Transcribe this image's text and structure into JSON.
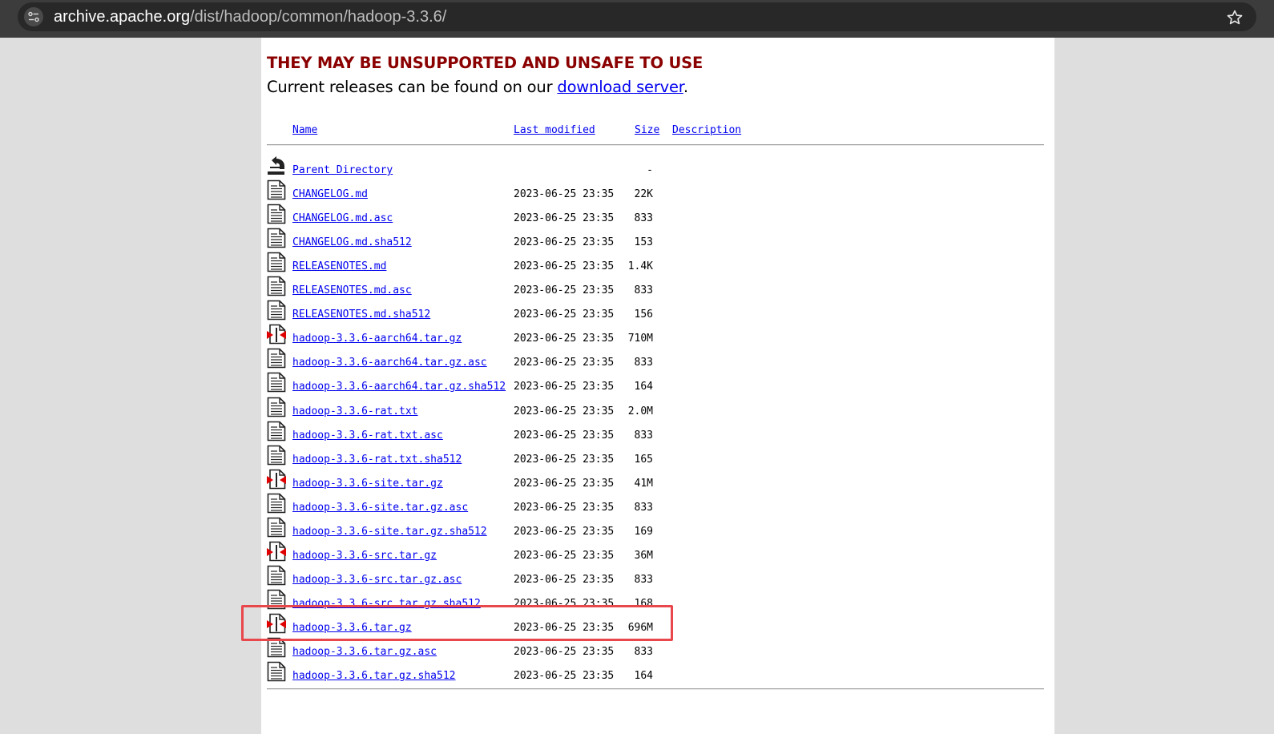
{
  "browser": {
    "url_host": "archive.apache.org",
    "url_path": "/dist/hadoop/common/hadoop-3.3.6/"
  },
  "page": {
    "warning": "THEY MAY BE UNSUPPORTED AND UNSAFE TO USE",
    "current_prefix": "Current releases can be found on our ",
    "current_link": "download server",
    "current_suffix": "."
  },
  "table": {
    "headers": {
      "name": "Name",
      "last_modified": "Last modified",
      "size": "Size",
      "description": "Description"
    },
    "rows": [
      {
        "icon": "back-arrow-icon",
        "name": "Parent Directory",
        "date": "",
        "size": "-"
      },
      {
        "icon": "text-file-icon",
        "name": "CHANGELOG.md",
        "date": "2023-06-25 23:35",
        "size": "22K"
      },
      {
        "icon": "text-file-icon",
        "name": "CHANGELOG.md.asc",
        "date": "2023-06-25 23:35",
        "size": "833"
      },
      {
        "icon": "text-file-icon",
        "name": "CHANGELOG.md.sha512",
        "date": "2023-06-25 23:35",
        "size": "153"
      },
      {
        "icon": "text-file-icon",
        "name": "RELEASENOTES.md",
        "date": "2023-06-25 23:35",
        "size": "1.4K"
      },
      {
        "icon": "text-file-icon",
        "name": "RELEASENOTES.md.asc",
        "date": "2023-06-25 23:35",
        "size": "833"
      },
      {
        "icon": "text-file-icon",
        "name": "RELEASENOTES.md.sha512",
        "date": "2023-06-25 23:35",
        "size": "156"
      },
      {
        "icon": "compressed-file-icon",
        "name": "hadoop-3.3.6-aarch64.tar.gz",
        "date": "2023-06-25 23:35",
        "size": "710M"
      },
      {
        "icon": "text-file-icon",
        "name": "hadoop-3.3.6-aarch64.tar.gz.asc",
        "date": "2023-06-25 23:35",
        "size": "833"
      },
      {
        "icon": "text-file-icon",
        "name": "hadoop-3.3.6-aarch64.tar.gz.sha512",
        "date": "2023-06-25 23:35",
        "size": "164"
      },
      {
        "icon": "text-file-icon",
        "name": "hadoop-3.3.6-rat.txt",
        "date": "2023-06-25 23:35",
        "size": "2.0M"
      },
      {
        "icon": "text-file-icon",
        "name": "hadoop-3.3.6-rat.txt.asc",
        "date": "2023-06-25 23:35",
        "size": "833"
      },
      {
        "icon": "text-file-icon",
        "name": "hadoop-3.3.6-rat.txt.sha512",
        "date": "2023-06-25 23:35",
        "size": "165"
      },
      {
        "icon": "compressed-file-icon",
        "name": "hadoop-3.3.6-site.tar.gz",
        "date": "2023-06-25 23:35",
        "size": "41M"
      },
      {
        "icon": "text-file-icon",
        "name": "hadoop-3.3.6-site.tar.gz.asc",
        "date": "2023-06-25 23:35",
        "size": "833"
      },
      {
        "icon": "text-file-icon",
        "name": "hadoop-3.3.6-site.tar.gz.sha512",
        "date": "2023-06-25 23:35",
        "size": "169"
      },
      {
        "icon": "compressed-file-icon",
        "name": "hadoop-3.3.6-src.tar.gz",
        "date": "2023-06-25 23:35",
        "size": "36M"
      },
      {
        "icon": "text-file-icon",
        "name": "hadoop-3.3.6-src.tar.gz.asc",
        "date": "2023-06-25 23:35",
        "size": "833"
      },
      {
        "icon": "text-file-icon",
        "name": "hadoop-3.3.6-src.tar.gz.sha512",
        "date": "2023-06-25 23:35",
        "size": "168"
      },
      {
        "icon": "compressed-file-icon",
        "name": "hadoop-3.3.6.tar.gz",
        "date": "2023-06-25 23:35",
        "size": "696M"
      },
      {
        "icon": "text-file-icon",
        "name": "hadoop-3.3.6.tar.gz.asc",
        "date": "2023-06-25 23:35",
        "size": "833"
      },
      {
        "icon": "text-file-icon",
        "name": "hadoop-3.3.6.tar.gz.sha512",
        "date": "2023-06-25 23:35",
        "size": "164"
      }
    ]
  },
  "colors": {
    "warning": "#8b0000",
    "link": "#0000ee",
    "highlight": "#e8474c"
  }
}
